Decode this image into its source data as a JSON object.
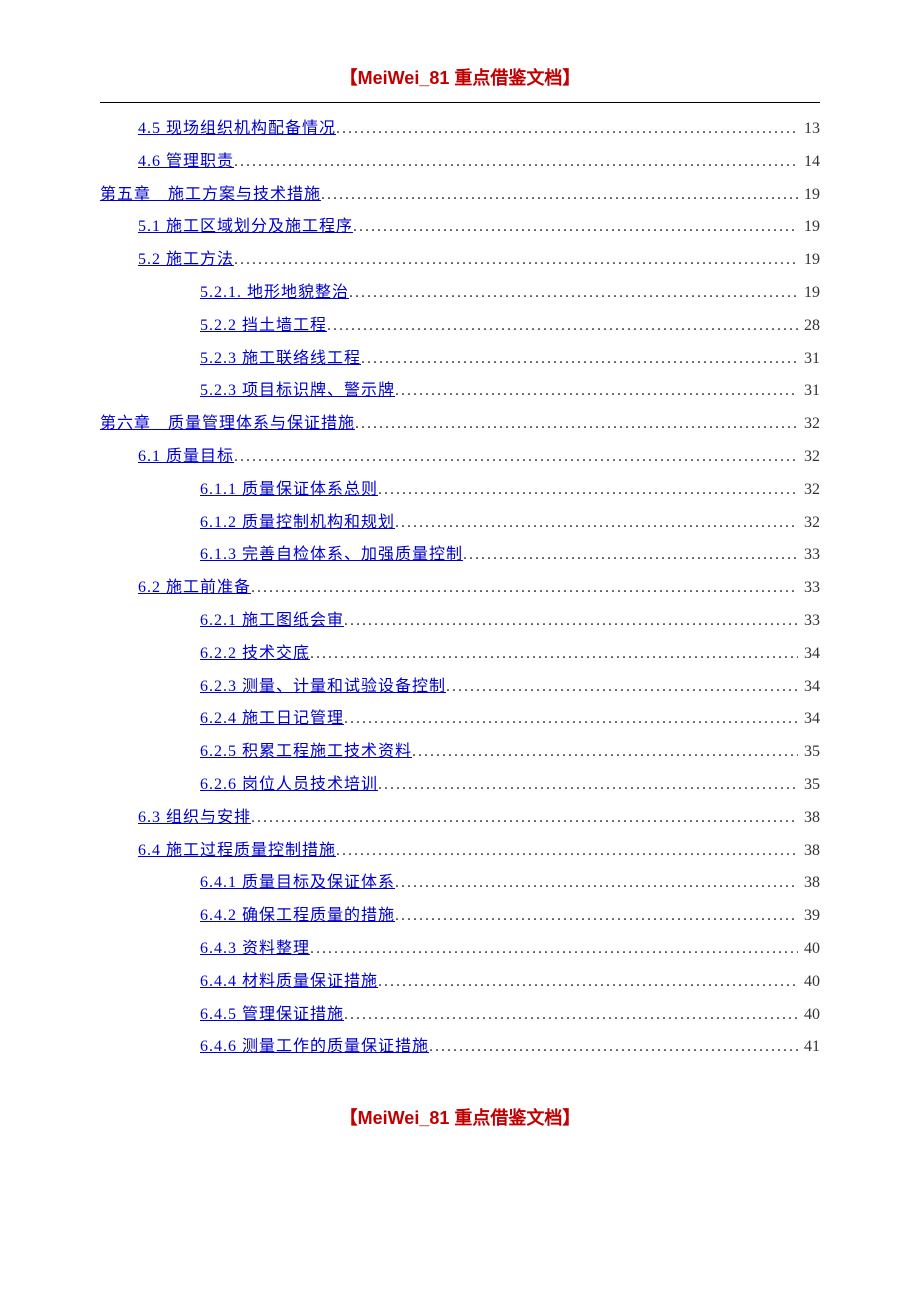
{
  "header": "【MeiWei_81 重点借鉴文档】",
  "footer": "【MeiWei_81 重点借鉴文档】",
  "toc": [
    {
      "level": 2,
      "label": "4.5 现场组织机构配备情况",
      "page": "13"
    },
    {
      "level": 2,
      "label": "4.6 管理职责",
      "page": "14"
    },
    {
      "level": 1,
      "label": "第五章　施工方案与技术措施",
      "page": "19"
    },
    {
      "level": 2,
      "label": "5.1 施工区域划分及施工程序",
      "page": "19"
    },
    {
      "level": 2,
      "label": "5.2 施工方法",
      "page": "19"
    },
    {
      "level": 3,
      "label": "5.2.1. 地形地貌整治",
      "page": "19"
    },
    {
      "level": 3,
      "label": "5.2.2 挡土墙工程",
      "page": "28"
    },
    {
      "level": 3,
      "label": "5.2.3 施工联络线工程",
      "page": "31"
    },
    {
      "level": 3,
      "label": "5.2.3 项目标识牌、警示牌",
      "page": "31"
    },
    {
      "level": 1,
      "label": "第六章　质量管理体系与保证措施",
      "page": "32"
    },
    {
      "level": 2,
      "label": "6.1 质量目标",
      "page": "32"
    },
    {
      "level": 3,
      "label": "6.1.1 质量保证体系总则",
      "page": "32"
    },
    {
      "level": 3,
      "label": "6.1.2 质量控制机构和规划",
      "page": "32"
    },
    {
      "level": 3,
      "label": "6.1.3 完善自检体系、加强质量控制",
      "page": "33"
    },
    {
      "level": 2,
      "label": "6.2 施工前准备",
      "page": "33"
    },
    {
      "level": 3,
      "label": "6.2.1 施工图纸会审",
      "page": "33"
    },
    {
      "level": 3,
      "label": "6.2.2 技术交底",
      "page": "34"
    },
    {
      "level": 3,
      "label": "6.2.3 测量、计量和试验设备控制",
      "page": "34"
    },
    {
      "level": 3,
      "label": "6.2.4 施工日记管理",
      "page": "34"
    },
    {
      "level": 3,
      "label": "6.2.5 积累工程施工技术资料",
      "page": "35"
    },
    {
      "level": 3,
      "label": "6.2.6 岗位人员技术培训",
      "page": "35"
    },
    {
      "level": 2,
      "label": "6.3 组织与安排",
      "page": "38"
    },
    {
      "level": 2,
      "label": "6.4 施工过程质量控制措施",
      "page": "38"
    },
    {
      "level": 3,
      "label": "6.4.1 质量目标及保证体系",
      "page": "38"
    },
    {
      "level": 3,
      "label": "6.4.2 确保工程质量的措施",
      "page": "39"
    },
    {
      "level": 3,
      "label": "6.4.3 资料整理",
      "page": "40"
    },
    {
      "level": 3,
      "label": "6.4.4 材料质量保证措施",
      "page": "40"
    },
    {
      "level": 3,
      "label": "6.4.5 管理保证措施",
      "page": "40"
    },
    {
      "level": 3,
      "label": "6.4.6 测量工作的质量保证措施",
      "page": "41"
    }
  ]
}
